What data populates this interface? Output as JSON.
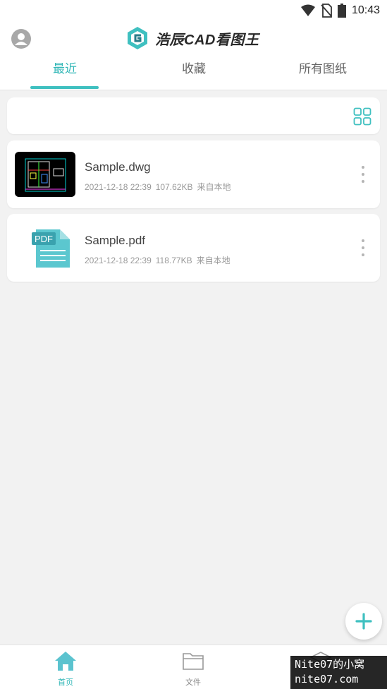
{
  "status_bar": {
    "time": "10:43",
    "icons": [
      "wifi-icon",
      "no-sim-icon",
      "battery-icon"
    ]
  },
  "app_bar": {
    "title": "浩辰CAD看图王",
    "avatar_icon": "avatar-icon"
  },
  "tabs": [
    {
      "label": "最近",
      "active": true
    },
    {
      "label": "收藏",
      "active": false
    },
    {
      "label": "所有图纸",
      "active": false
    }
  ],
  "files": [
    {
      "name": "Sample.dwg",
      "date": "2021-12-18 22:39",
      "size": "107.62KB",
      "source": "来自本地",
      "type": "dwg"
    },
    {
      "name": "Sample.pdf",
      "date": "2021-12-18 22:39",
      "size": "118.77KB",
      "source": "来自本地",
      "type": "pdf"
    }
  ],
  "pdf_thumb_label": "PDF",
  "bottom_nav": [
    {
      "label": "首页",
      "icon": "home-icon",
      "active": true
    },
    {
      "label": "文件",
      "icon": "folder-icon",
      "active": false
    },
    {
      "label": "",
      "icon": "layers-icon",
      "active": false
    }
  ],
  "watermark": {
    "line1": "Nite07的小窝",
    "line2": "nite07.com"
  },
  "colors": {
    "accent": "#3fc0c0",
    "background": "#f2f2f2"
  }
}
